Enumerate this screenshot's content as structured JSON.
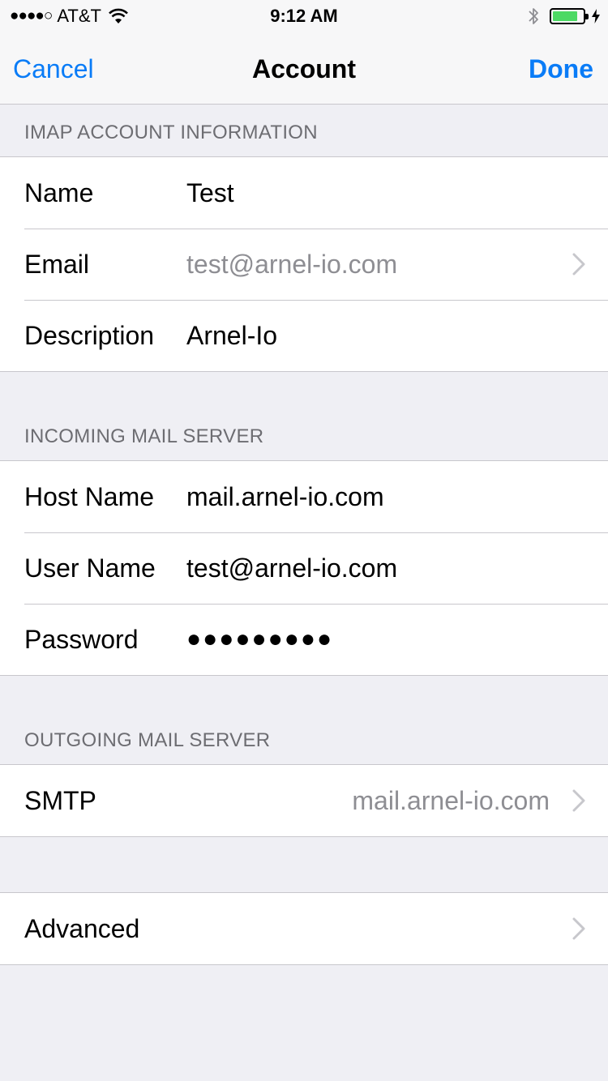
{
  "status_bar": {
    "signal": "●●●●○",
    "carrier": "AT&T",
    "time": "9:12 AM",
    "battery_level": 0.85
  },
  "nav": {
    "cancel_label": "Cancel",
    "title": "Account",
    "done_label": "Done"
  },
  "sections": {
    "imap": {
      "header": "IMAP ACCOUNT INFORMATION",
      "name": {
        "label": "Name",
        "value": "Test"
      },
      "email": {
        "label": "Email",
        "value": "test@arnel-io.com"
      },
      "description": {
        "label": "Description",
        "value": "Arnel-Io"
      }
    },
    "incoming": {
      "header": "INCOMING MAIL SERVER",
      "host": {
        "label": "Host Name",
        "value": "mail.arnel-io.com"
      },
      "user": {
        "label": "User Name",
        "value": "test@arnel-io.com"
      },
      "password": {
        "label": "Password",
        "value": "●●●●●●●●●"
      }
    },
    "outgoing": {
      "header": "OUTGOING MAIL SERVER",
      "smtp": {
        "label": "SMTP",
        "value": "mail.arnel-io.com"
      }
    },
    "advanced": {
      "label": "Advanced"
    }
  },
  "icons": {
    "wifi": "wifi-icon",
    "bluetooth": "bluetooth-icon",
    "battery": "battery-icon",
    "charging": "charging-bolt-icon",
    "disclosure": "chevron-right-icon"
  },
  "colors": {
    "accent": "#0a7cf7",
    "background": "#efeff4",
    "secondary_text": "#8e8e93",
    "battery_fill": "#4cd964"
  }
}
